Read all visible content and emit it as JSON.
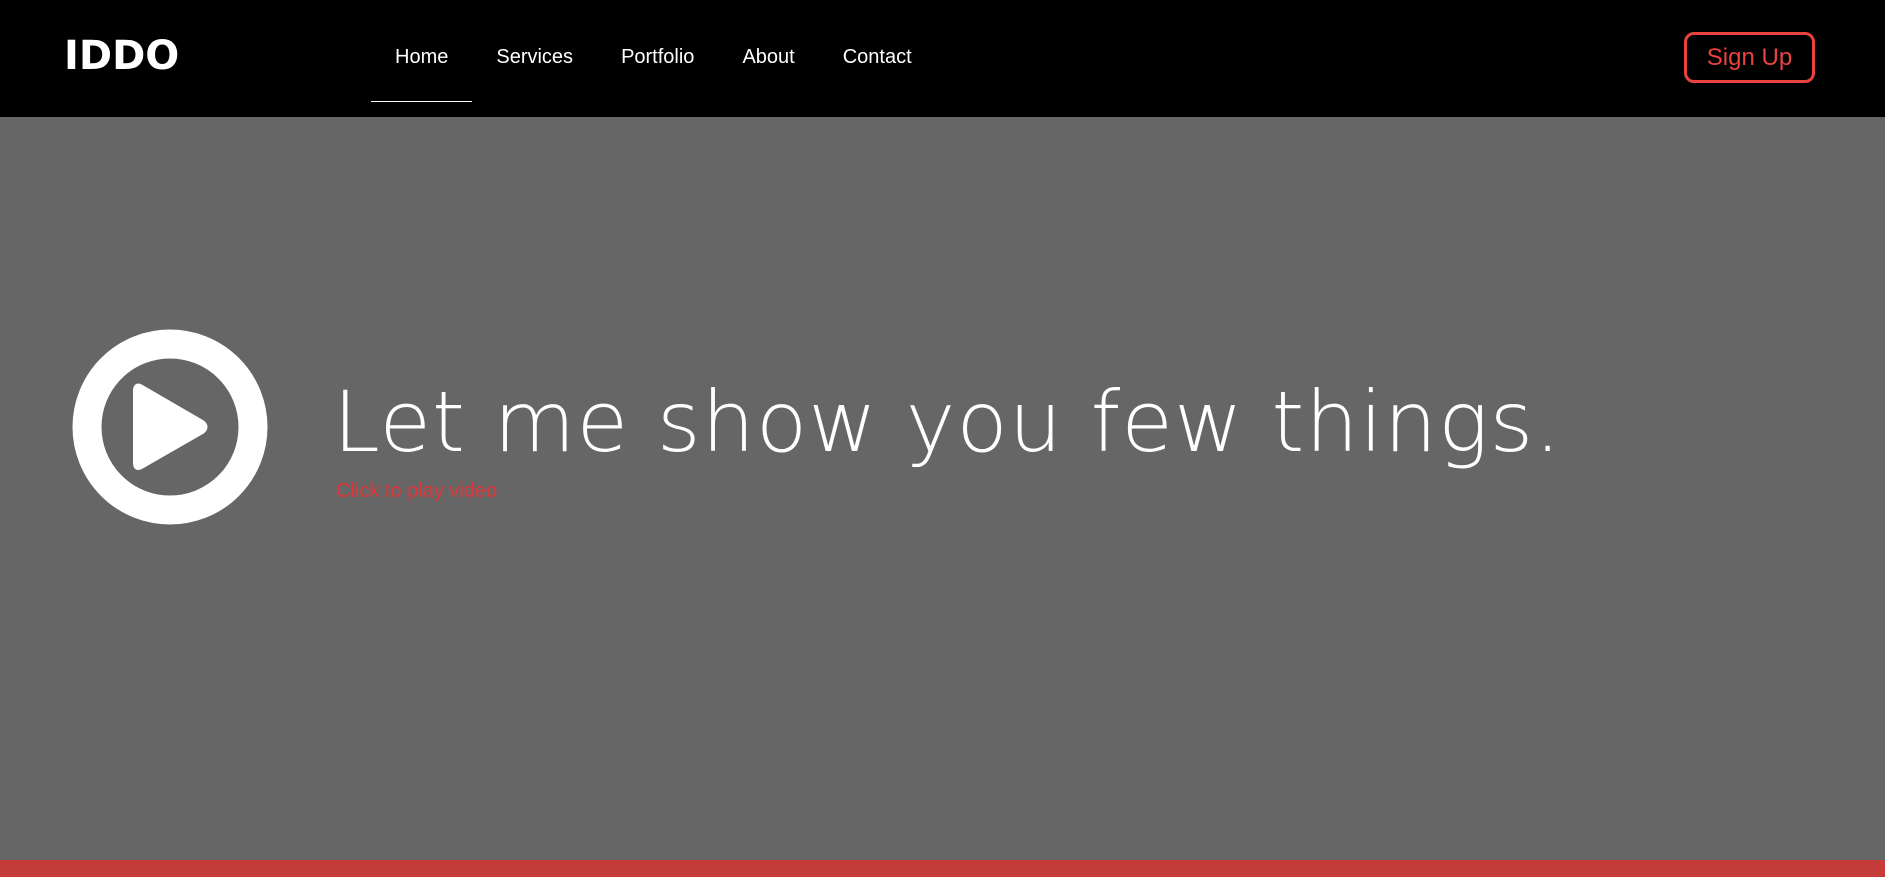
{
  "header": {
    "logo": "IDDO",
    "nav": [
      {
        "label": "Home",
        "active": true
      },
      {
        "label": "Services",
        "active": false
      },
      {
        "label": "Portfolio",
        "active": false
      },
      {
        "label": "About",
        "active": false
      },
      {
        "label": "Contact",
        "active": false
      }
    ],
    "signup_label": "Sign Up"
  },
  "hero": {
    "headline": "Let me show you few things.",
    "subcaption": "Click to play video",
    "play_icon": "play-circle-icon"
  },
  "colors": {
    "nav_bg": "#000000",
    "hero_bg": "#666666",
    "accent": "#e8433f",
    "footer_bar": "#c43b39",
    "text": "#ffffff"
  }
}
